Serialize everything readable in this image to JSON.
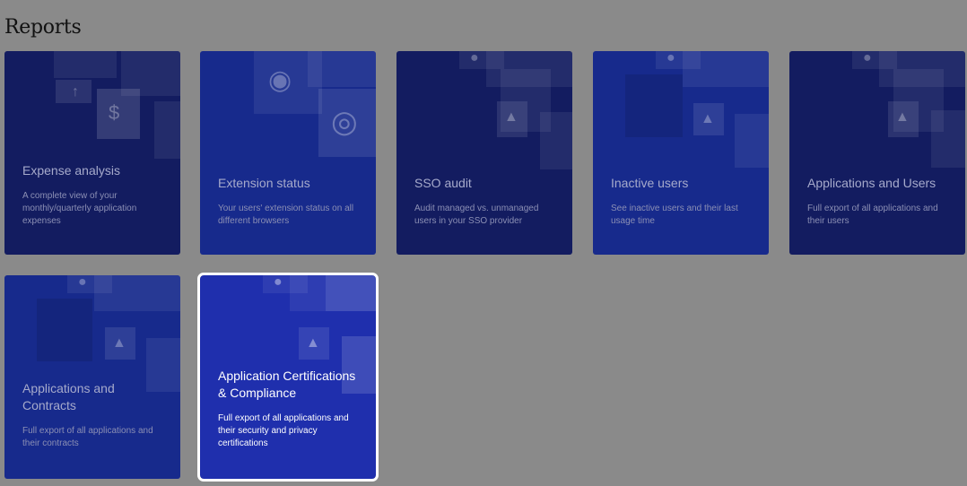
{
  "page": {
    "title": "Reports"
  },
  "cards": [
    {
      "title": "Expense analysis",
      "description": "A complete view of your monthly/quarterly application expenses"
    },
    {
      "title": "Extension status",
      "description": "Your users' extension status on all different browsers"
    },
    {
      "title": "SSO audit",
      "description": "Audit managed vs. unmanaged users in your SSO provider"
    },
    {
      "title": "Inactive users",
      "description": "See inactive users and their last usage time"
    },
    {
      "title": "Applications and Users",
      "description": "Full export of all applications and their users"
    },
    {
      "title": "Applications and Contracts",
      "description": "Full export of all applications and their contracts"
    },
    {
      "title": "Application Certifications & Compliance",
      "description": "Full export of all applications and their security and privacy certifications"
    }
  ],
  "selected_card": "Application Certifications & Compliance"
}
